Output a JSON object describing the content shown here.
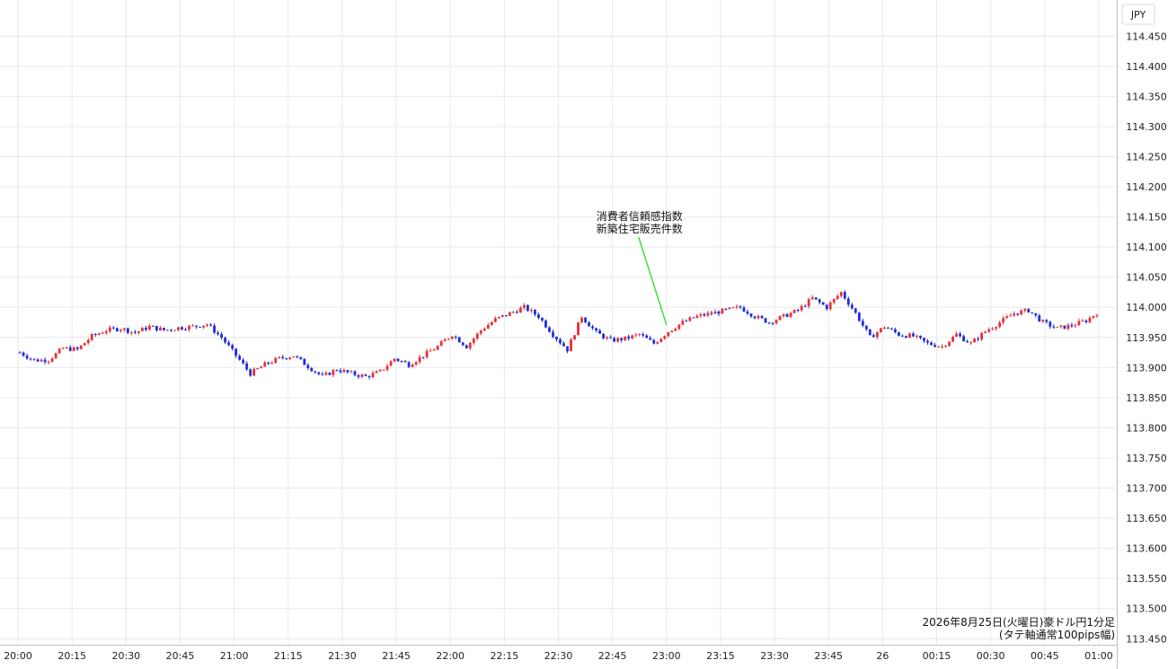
{
  "chart_data": {
    "type": "candlestick",
    "price_unit": "JPY",
    "up_color": "#e8303a",
    "down_color": "#1f2fd6",
    "annotation_line_color": "#3fe03a",
    "grid": true,
    "ylim": [
      113.44,
      114.51
    ],
    "y_ticks": [
      "114.450",
      "114.400",
      "114.350",
      "114.300",
      "114.250",
      "114.200",
      "114.150",
      "114.100",
      "114.050",
      "114.000",
      "113.950",
      "113.900",
      "113.850",
      "113.800",
      "113.750",
      "113.700",
      "113.650",
      "113.600",
      "113.550",
      "113.500",
      "113.450"
    ],
    "x_ticks": [
      "20:00",
      "20:15",
      "20:30",
      "20:45",
      "21:00",
      "21:15",
      "21:30",
      "21:45",
      "22:00",
      "22:15",
      "22:30",
      "22:45",
      "23:00",
      "23:15",
      "23:30",
      "23:45",
      "26",
      "00:15",
      "00:30",
      "00:45",
      "01:00"
    ],
    "series": [
      {
        "t": "20:00",
        "p": 113.925
      },
      {
        "t": "20:04",
        "p": 113.912
      },
      {
        "t": "20:08",
        "p": 113.913
      },
      {
        "t": "20:12",
        "p": 113.932
      },
      {
        "t": "20:16",
        "p": 113.93
      },
      {
        "t": "20:20",
        "p": 113.952
      },
      {
        "t": "20:24",
        "p": 113.962
      },
      {
        "t": "20:28",
        "p": 113.965
      },
      {
        "t": "20:32",
        "p": 113.958
      },
      {
        "t": "20:36",
        "p": 113.968
      },
      {
        "t": "20:40",
        "p": 113.962
      },
      {
        "t": "20:44",
        "p": 113.966
      },
      {
        "t": "20:48",
        "p": 113.968
      },
      {
        "t": "20:52",
        "p": 113.972
      },
      {
        "t": "20:56",
        "p": 113.95
      },
      {
        "t": "21:00",
        "p": 113.92
      },
      {
        "t": "21:04",
        "p": 113.89
      },
      {
        "t": "21:08",
        "p": 113.905
      },
      {
        "t": "21:12",
        "p": 113.915
      },
      {
        "t": "21:16",
        "p": 113.92
      },
      {
        "t": "21:20",
        "p": 113.902
      },
      {
        "t": "21:24",
        "p": 113.885
      },
      {
        "t": "21:28",
        "p": 113.897
      },
      {
        "t": "21:32",
        "p": 113.89
      },
      {
        "t": "21:36",
        "p": 113.885
      },
      {
        "t": "21:40",
        "p": 113.893
      },
      {
        "t": "21:44",
        "p": 113.915
      },
      {
        "t": "21:48",
        "p": 113.905
      },
      {
        "t": "21:52",
        "p": 113.92
      },
      {
        "t": "21:56",
        "p": 113.935
      },
      {
        "t": "22:00",
        "p": 113.955
      },
      {
        "t": "22:04",
        "p": 113.935
      },
      {
        "t": "22:08",
        "p": 113.962
      },
      {
        "t": "22:12",
        "p": 113.98
      },
      {
        "t": "22:16",
        "p": 113.99
      },
      {
        "t": "22:20",
        "p": 114.0
      },
      {
        "t": "22:24",
        "p": 113.985
      },
      {
        "t": "22:28",
        "p": 113.955
      },
      {
        "t": "22:32",
        "p": 113.93
      },
      {
        "t": "22:36",
        "p": 113.985
      },
      {
        "t": "22:40",
        "p": 113.958
      },
      {
        "t": "22:44",
        "p": 113.945
      },
      {
        "t": "22:48",
        "p": 113.948
      },
      {
        "t": "22:52",
        "p": 113.955
      },
      {
        "t": "22:56",
        "p": 113.94
      },
      {
        "t": "23:00",
        "p": 113.96
      },
      {
        "t": "23:04",
        "p": 113.975
      },
      {
        "t": "23:08",
        "p": 113.985
      },
      {
        "t": "23:12",
        "p": 113.99
      },
      {
        "t": "23:16",
        "p": 113.995
      },
      {
        "t": "23:20",
        "p": 114.0
      },
      {
        "t": "23:24",
        "p": 113.985
      },
      {
        "t": "23:28",
        "p": 113.975
      },
      {
        "t": "23:32",
        "p": 113.985
      },
      {
        "t": "23:36",
        "p": 113.995
      },
      {
        "t": "23:40",
        "p": 114.015
      },
      {
        "t": "23:44",
        "p": 114.0
      },
      {
        "t": "23:48",
        "p": 114.025
      },
      {
        "t": "23:52",
        "p": 113.99
      },
      {
        "t": "23:56",
        "p": 113.95
      },
      {
        "t": "00:00",
        "p": 113.968
      },
      {
        "t": "00:04",
        "p": 113.955
      },
      {
        "t": "00:08",
        "p": 113.952
      },
      {
        "t": "00:12",
        "p": 113.94
      },
      {
        "t": "00:16",
        "p": 113.935
      },
      {
        "t": "00:20",
        "p": 113.955
      },
      {
        "t": "00:24",
        "p": 113.94
      },
      {
        "t": "00:28",
        "p": 113.96
      },
      {
        "t": "00:32",
        "p": 113.975
      },
      {
        "t": "00:36",
        "p": 113.99
      },
      {
        "t": "00:40",
        "p": 113.995
      },
      {
        "t": "00:44",
        "p": 113.975
      },
      {
        "t": "00:48",
        "p": 113.965
      },
      {
        "t": "00:52",
        "p": 113.97
      },
      {
        "t": "00:56",
        "p": 113.978
      },
      {
        "t": "01:00",
        "p": 113.995
      }
    ],
    "annotation": {
      "lines": [
        "消費者信頼感指数",
        "新築住宅販売件数"
      ],
      "time": "23:00",
      "price": 113.965
    },
    "caption_lines": [
      "2026年8月25日(火曜日)豪ドル円1分足",
      "(タテ軸通常100pips幅)"
    ]
  }
}
